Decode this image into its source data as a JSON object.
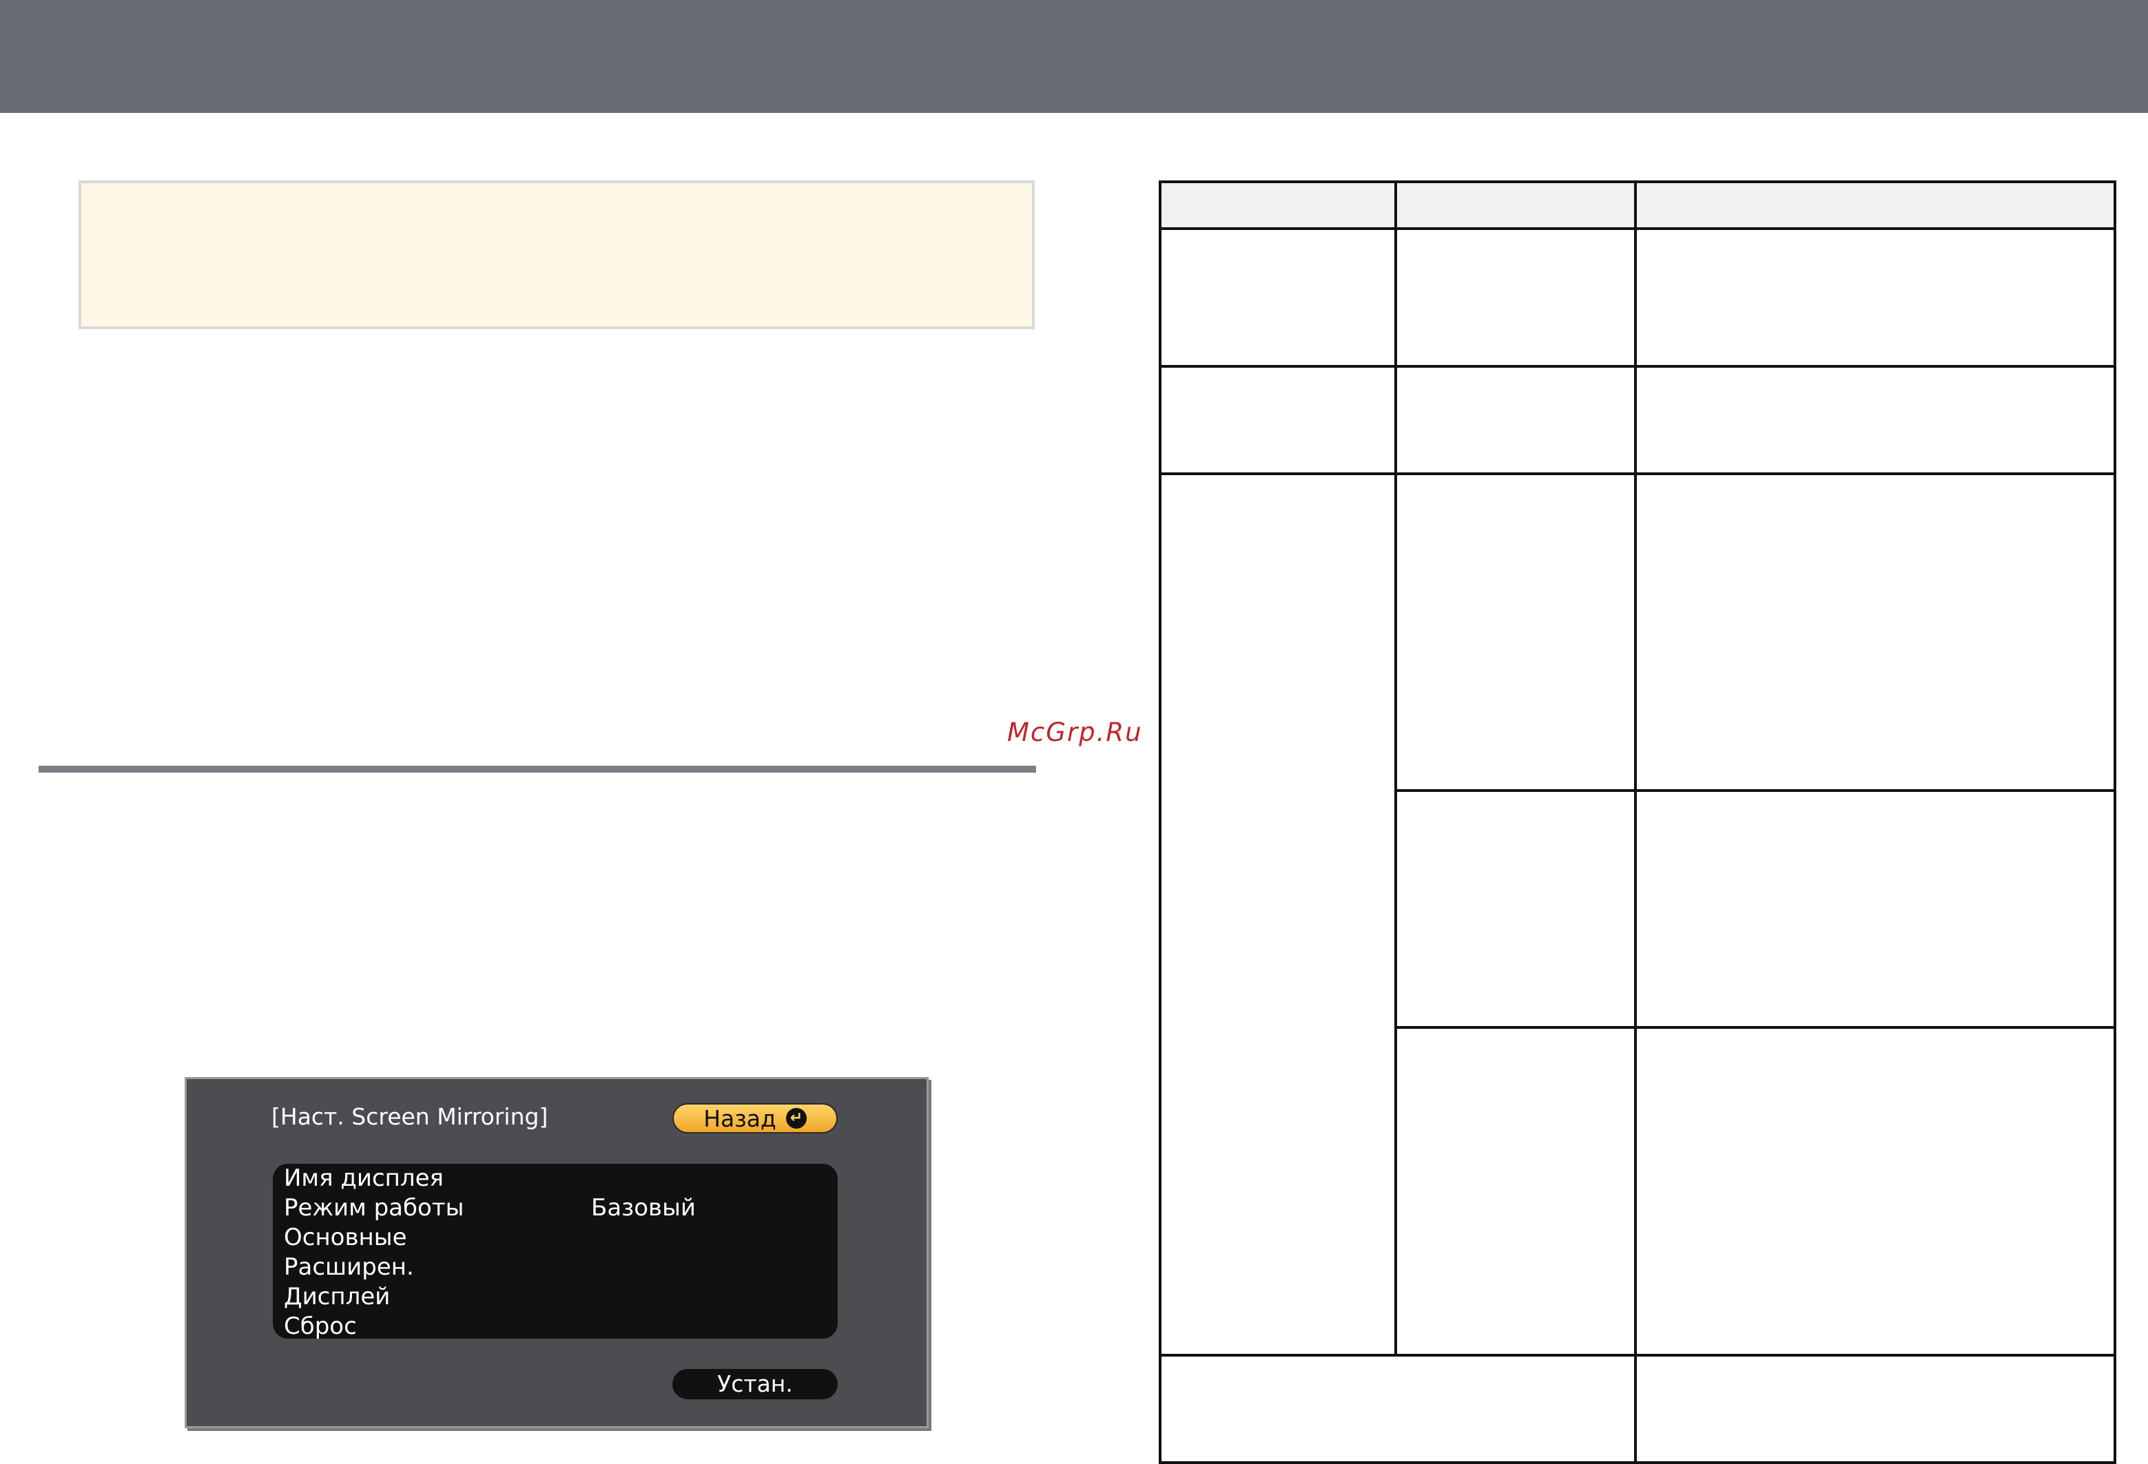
{
  "watermark": {
    "text": "McGrp.Ru"
  },
  "osd": {
    "title": "[Наст. Screen Mirroring]",
    "back_button": "Назад",
    "enter_icon": "enter-icon",
    "items": [
      {
        "label": "Имя дисплея",
        "value": ""
      },
      {
        "label": "Режим работы",
        "value": "Базовый"
      },
      {
        "label": "Основные",
        "value": ""
      },
      {
        "label": "Расширен.",
        "value": ""
      },
      {
        "label": "Дисплей",
        "value": ""
      },
      {
        "label": "Сброс",
        "value": ""
      }
    ],
    "set_button": "Устан."
  },
  "colors": {
    "top_bar": "#686b74",
    "note_background": "#fdf8e6",
    "watermark": "#c0262b",
    "osd_background": "#4b4d50",
    "back_button": "#f0a828"
  }
}
